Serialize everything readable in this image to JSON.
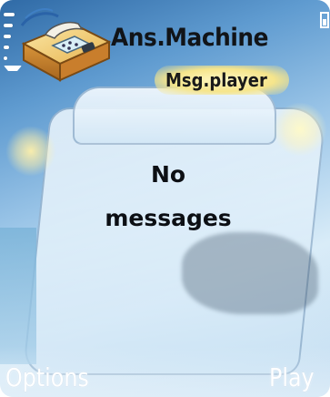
{
  "app": {
    "title": "Ans.Machine",
    "subtitle": "Msg.player",
    "icon": "answering-machine-icon"
  },
  "content": {
    "line1": "No",
    "line2": "messages"
  },
  "softkeys": {
    "left": "Options",
    "right": "Play"
  },
  "status": {
    "signal_icon": "signal-strength-icon",
    "battery_icon": "battery-icon"
  },
  "colors": {
    "title_text": "#111418",
    "subtitle_highlight": "#f6e58b",
    "softkey_text": "#ffffff",
    "wallpaper_primary": "#5f9bd0"
  }
}
